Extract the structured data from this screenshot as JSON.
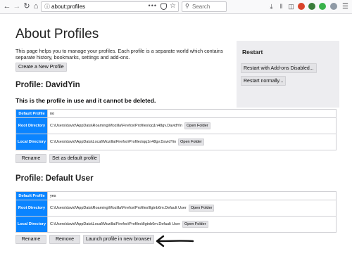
{
  "browser": {
    "url": "about:profiles",
    "url_dots": "•••",
    "search_placeholder": "Search",
    "icons": [
      "back-icon",
      "forward-icon",
      "reload-icon",
      "home-icon",
      "info-icon",
      "pocket-icon",
      "bookmark-star-icon",
      "download-icon",
      "library-icon",
      "sidebar-icon",
      "addon-icon",
      "addon-icon",
      "account-icon",
      "menu-icon"
    ]
  },
  "page": {
    "title": "About Profiles",
    "intro": "This page helps you to manage your profiles. Each profile is a separate world which contains separate history, bookmarks, settings and add-ons.",
    "create_button": "Create a New Profile"
  },
  "restart": {
    "title": "Restart",
    "addons_disabled_button": "Restart with Add-ons Disabled...",
    "normally_button": "Restart normally..."
  },
  "profiles": [
    {
      "heading": "Profile: DavidYin",
      "warning": "This is the profile in use and it cannot be deleted.",
      "labels": {
        "default_profile": "Default Profile",
        "root_directory": "Root Directory",
        "local_directory": "Local Directory"
      },
      "default_value": "no",
      "root_path": "C:\\Users\\david\\AppData\\Roaming\\Mozilla\\Firefox\\Profiles\\qq1n48gv.DavidYin",
      "local_path": "C:\\Users\\david\\AppData\\Local\\Mozilla\\Firefox\\Profiles\\qq1n48gv.DavidYin",
      "open_folder": "Open Folder",
      "buttons": {
        "rename": "Rename",
        "set_default": "Set as default profile"
      }
    },
    {
      "heading": "Profile: Default User",
      "labels": {
        "default_profile": "Default Profile",
        "root_directory": "Root Directory",
        "local_directory": "Local Directory"
      },
      "default_value": "yes",
      "root_path": "C:\\Users\\david\\AppData\\Roaming\\Mozilla\\Firefox\\Profiles\\llgtnb6m.Default User",
      "local_path": "C:\\Users\\david\\AppData\\Local\\Mozilla\\Firefox\\Profiles\\llgtnb6m.Default User",
      "open_folder": "Open Folder",
      "buttons": {
        "rename": "Rename",
        "remove": "Remove",
        "launch": "Launch profile in new browser"
      }
    }
  ],
  "colors": {
    "label_cell": "#0a84ff",
    "button": "#e3e3e6",
    "restart_panel": "#ededf0"
  }
}
